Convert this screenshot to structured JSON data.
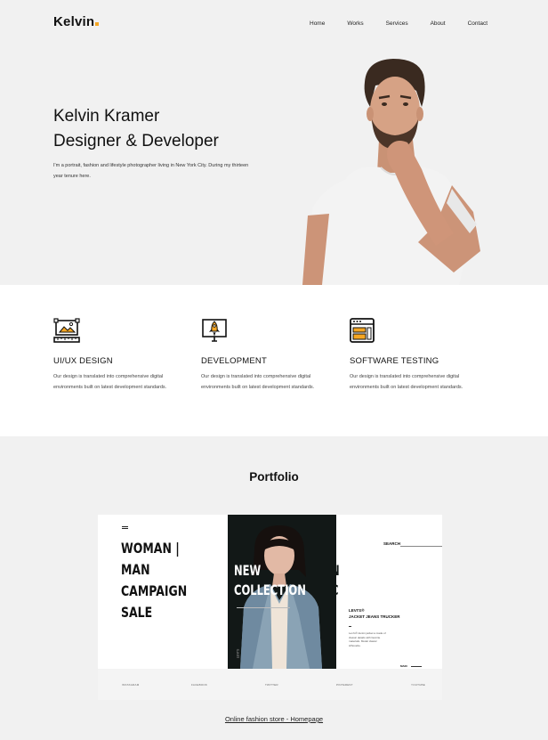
{
  "brand": {
    "name": "Kelvin",
    "accent": "#f5a623"
  },
  "nav": [
    "Home",
    "Works",
    "Services",
    "About",
    "Contact"
  ],
  "hero": {
    "line1": "Kelvin Kramer",
    "line2": "Designer & Developer",
    "text": "I'm a portrait, fashion and lifestyle photographer living in New York City. During my thirteen year tenure here."
  },
  "services": [
    {
      "icon": "ui-design-icon",
      "title": "UI/UX DESIGN",
      "desc": "Our design is translated into comprehensive digital environments built on latest development standards."
    },
    {
      "icon": "rocket-monitor-icon",
      "title": "DEVELOPMENT",
      "desc": "Our design is translated into comprehensive digital environments built on latest development standards."
    },
    {
      "icon": "browser-layout-icon",
      "title": "SOFTWARE TESTING",
      "desc": "Our design is translated into comprehensive digital environments built on latest development standards."
    }
  ],
  "portfolio": {
    "title": "Portfolio",
    "link": "Online fashion store - Homepage",
    "mockup": {
      "headline": [
        "WOMAN |",
        "MAN",
        "CAMPAIGN",
        "SALE"
      ],
      "collection": [
        "NEW",
        "COLLECTION"
      ],
      "peek": [
        "N",
        "C"
      ],
      "search": "SEARCH",
      "product": [
        "LEVI'S®",
        "JACKET JEANS TRUCKER"
      ],
      "product_desc": "Levi's® denim jacket a made of classic details with favorite materials. Model classic silhouette.",
      "more": "MAIN",
      "vertical": "LEVI'S",
      "footer": [
        "INSTAGRAM",
        "FACEBOOK",
        "TWITTER",
        "PINTEREST",
        "YOUTUBE"
      ]
    }
  }
}
